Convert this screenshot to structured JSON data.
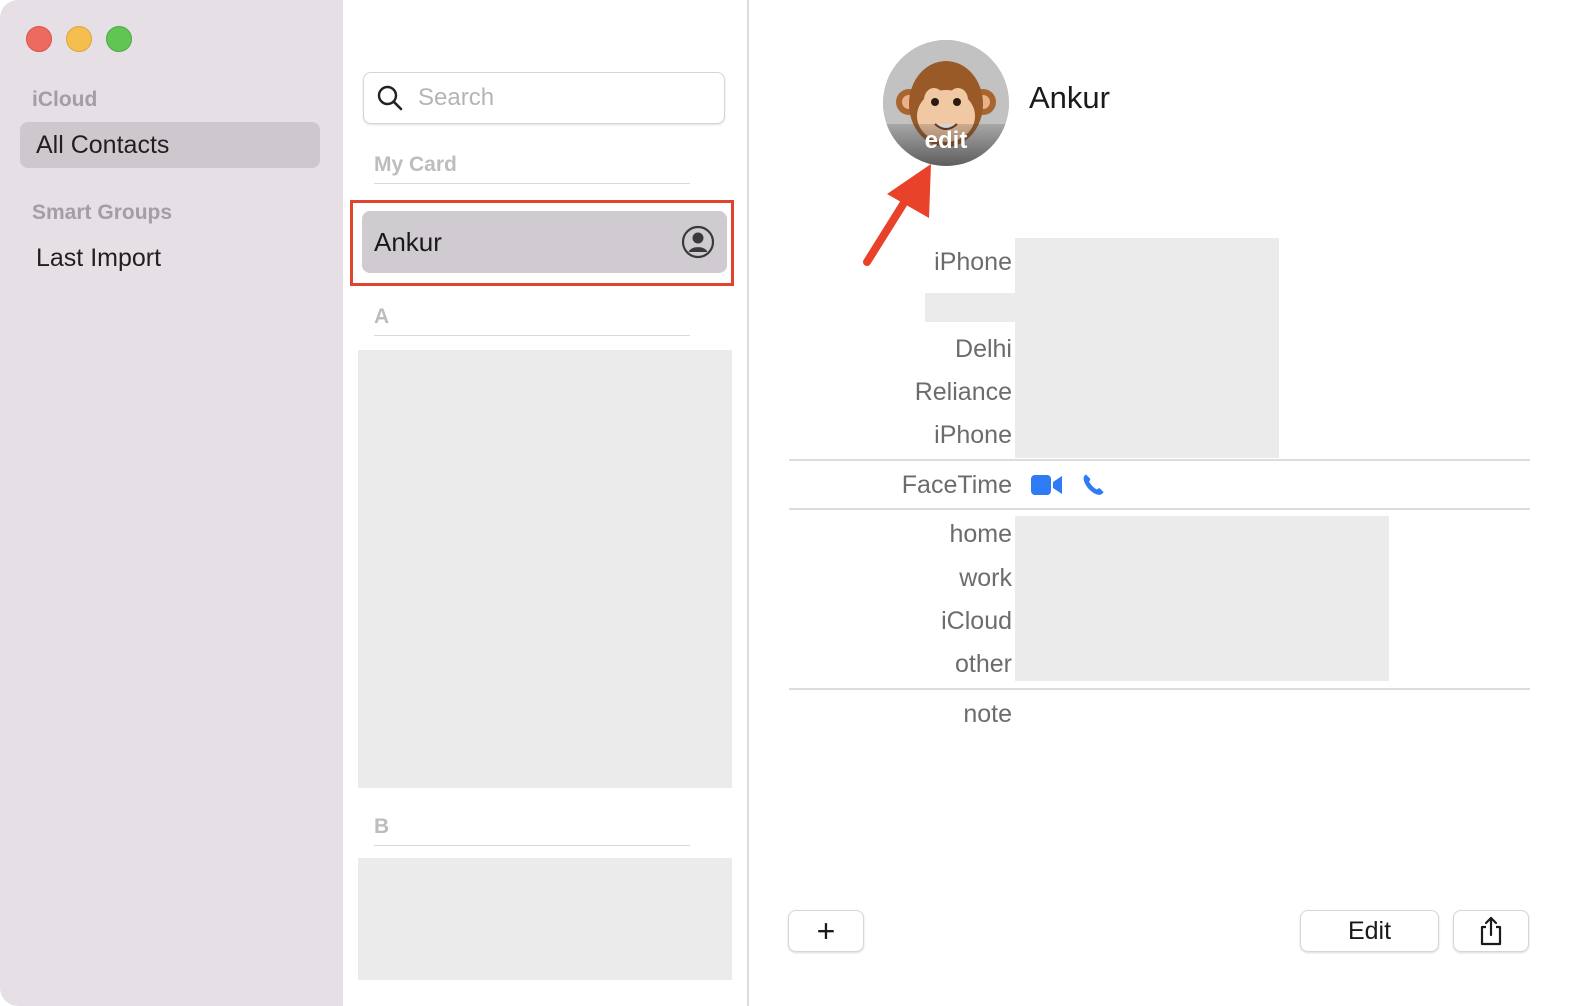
{
  "window": {
    "traffic_lights": [
      "close",
      "minimize",
      "zoom"
    ]
  },
  "sidebar": {
    "account_heading": "iCloud",
    "account_items": [
      {
        "label": "All Contacts",
        "selected": true
      }
    ],
    "smart_heading": "Smart Groups",
    "smart_items": [
      {
        "label": "Last Import"
      }
    ]
  },
  "list": {
    "search": {
      "placeholder": "Search",
      "value": ""
    },
    "my_card_label": "My Card",
    "my_card_name": "Ankur",
    "sections": [
      "A",
      "B"
    ]
  },
  "detail": {
    "name": "Ankur",
    "avatar_edit_label": "edit",
    "fields_top": [
      "iPhone",
      "Delhi",
      "Reliance",
      "iPhone"
    ],
    "facetime_label": "FaceTime",
    "email_labels": [
      "home",
      "work",
      "iCloud",
      "other"
    ],
    "note_label": "note",
    "add_button": "+",
    "edit_button": "Edit"
  },
  "colors": {
    "highlight": "#e0452b",
    "accent": "#2f7bf5",
    "arrow": "#e8432a"
  },
  "icons": [
    "search-icon",
    "me-card-icon",
    "video-icon",
    "phone-icon",
    "share-icon",
    "plus-icon"
  ]
}
